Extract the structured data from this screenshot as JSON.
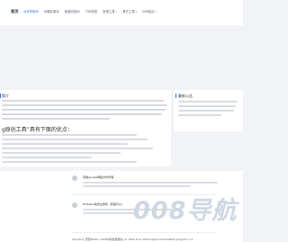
{
  "header": {
    "logo": "首页",
    "nav": [
      {
        "label": "AI写作助手",
        "active": true,
        "has_dropdown": false
      },
      {
        "label": "AI图片助手",
        "has_dropdown": false
      },
      {
        "label": "免费问答AI",
        "has_dropdown": false
      },
      {
        "label": "TXK在线",
        "has_dropdown": false
      },
      {
        "label": "查询工具",
        "has_dropdown": true
      },
      {
        "label": "其它工具",
        "has_dropdown": true
      },
      {
        "label": "008站点",
        "has_dropdown": true
      }
    ]
  },
  "intro_card": {
    "heading": "简介",
    "advantages_title": "g原创工具”具有下面的优点："
  },
  "side_card": {
    "heading": "最新公告"
  },
  "answers": {
    "items": [
      {
        "question": "查看google网络文件管理"
      },
      {
        "question": "Enfeplus免费主题吗（原理可以）"
      }
    ],
    "bottom": "php linux 安装Redis: LGPHPI的集数量在 co. fatal error killed signal terminated program cc1"
  },
  "watermark": {
    "text": "008导航"
  },
  "colors": {
    "accent": "#2d6ff7",
    "background": "#f1f3f6",
    "watermark": "#cfd7e3"
  }
}
